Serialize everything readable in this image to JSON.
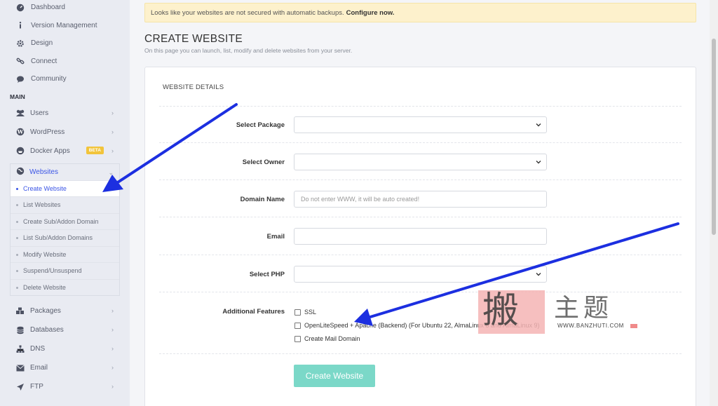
{
  "sidebar": {
    "top_items": [
      {
        "label": "Dashboard",
        "icon": "dashboard-icon"
      },
      {
        "label": "Version Management",
        "icon": "info-icon"
      },
      {
        "label": "Design",
        "icon": "gear-icon"
      },
      {
        "label": "Connect",
        "icon": "link-icon"
      },
      {
        "label": "Community",
        "icon": "chat-icon"
      }
    ],
    "section_label": "MAIN",
    "main_items": [
      {
        "label": "Users",
        "icon": "users-icon"
      },
      {
        "label": "WordPress",
        "icon": "wordpress-icon"
      },
      {
        "label": "Docker Apps",
        "icon": "docker-icon",
        "badge": "BETA"
      }
    ],
    "websites_label": "Websites",
    "websites_sub": [
      {
        "label": "Create Website",
        "active": true
      },
      {
        "label": "List Websites"
      },
      {
        "label": "Create Sub/Addon Domain"
      },
      {
        "label": "List Sub/Addon Domains"
      },
      {
        "label": "Modify Website"
      },
      {
        "label": "Suspend/Unsuspend"
      },
      {
        "label": "Delete Website"
      }
    ],
    "lower_items": [
      {
        "label": "Packages",
        "icon": "packages-icon"
      },
      {
        "label": "Databases",
        "icon": "database-icon"
      },
      {
        "label": "DNS",
        "icon": "sitemap-icon"
      },
      {
        "label": "Email",
        "icon": "envelope-icon"
      },
      {
        "label": "FTP",
        "icon": "upload-icon"
      }
    ]
  },
  "alert": {
    "text": "Looks like your websites are not secured with automatic backups.",
    "link": "Configure now."
  },
  "page": {
    "title": "CREATE WEBSITE",
    "subtitle": "On this page you can launch, list, modify and delete websites from your server."
  },
  "form": {
    "section_title": "WEBSITE DETAILS",
    "select_package_label": "Select Package",
    "select_owner_label": "Select Owner",
    "domain_name_label": "Domain Name",
    "domain_placeholder": "Do not enter WWW, it will be auto created!",
    "email_label": "Email",
    "select_php_label": "Select PHP",
    "additional_features_label": "Additional Features",
    "features": [
      "SSL",
      "OpenLiteSpeed + Apache (Backend) (For Ubuntu 22, AlmaLinux 8 and AlmaLinux 9)",
      "Create Mail Domain"
    ],
    "submit_label": "Create Website"
  },
  "watermark": {
    "big_char": "搬",
    "chinese": "主题",
    "url": "WWW.BANZHUTI.COM"
  },
  "colors": {
    "accent": "#3b55e6",
    "button": "#7bd8c8",
    "alert_bg": "#fdf1cc",
    "arrow": "#1c2fe0"
  }
}
